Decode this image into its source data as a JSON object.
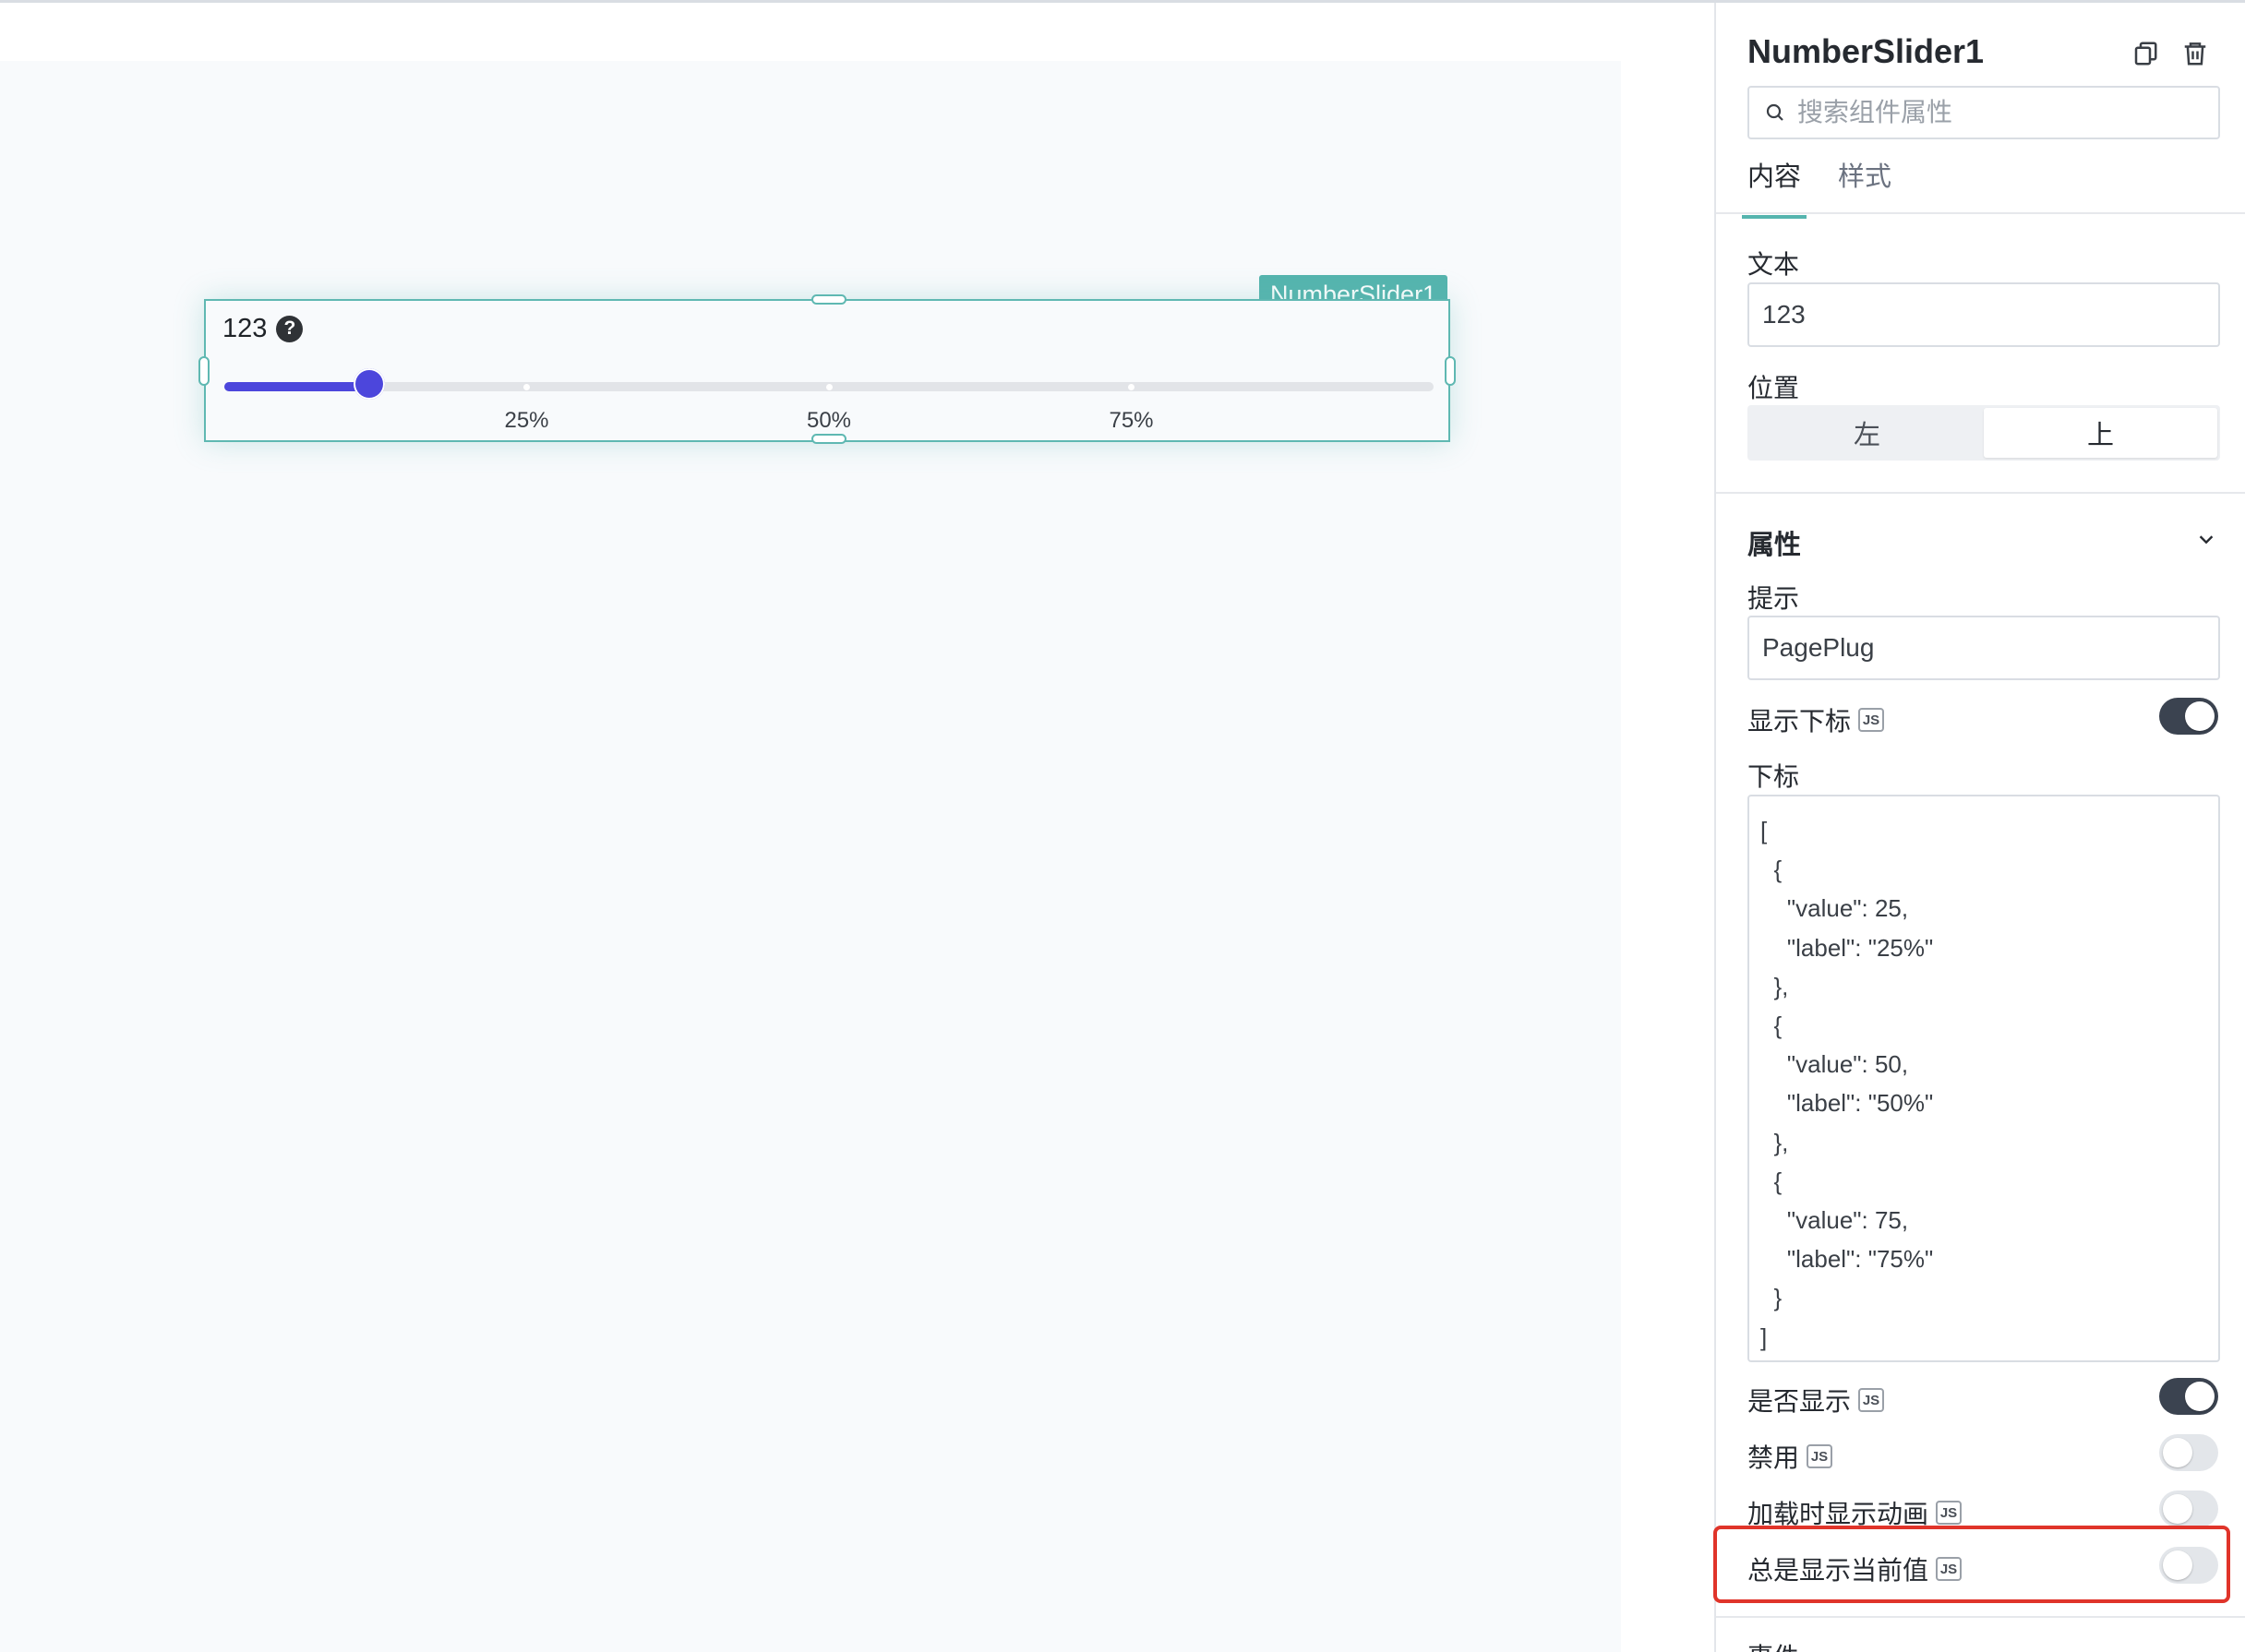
{
  "canvas": {
    "widget_tag": "NumberSlider1",
    "slider": {
      "label": "123",
      "value_percent": 12,
      "marks": [
        {
          "value": 25,
          "label": "25%"
        },
        {
          "value": 50,
          "label": "50%"
        },
        {
          "value": 75,
          "label": "75%"
        }
      ]
    }
  },
  "panel": {
    "title": "NumberSlider1",
    "copy_icon": "copy-icon",
    "delete_icon": "trash-icon",
    "search_placeholder": "搜索组件属性",
    "tabs": [
      {
        "label": "内容",
        "active": true
      },
      {
        "label": "样式",
        "active": false
      }
    ],
    "text_field": {
      "label": "文本",
      "value": "123"
    },
    "position": {
      "label": "位置",
      "options": [
        "左",
        "上"
      ],
      "selected": "上"
    },
    "properties": {
      "title": "属性",
      "hint": {
        "label": "提示",
        "value": "PagePlug"
      },
      "show_marks": {
        "label": "显示下标",
        "on": true
      },
      "marks": {
        "label": "下标",
        "code": "[\n  {\n    \"value\": 25,\n    \"label\": \"25%\"\n  },\n  {\n    \"value\": 50,\n    \"label\": \"50%\"\n  },\n  {\n    \"value\": 75,\n    \"label\": \"75%\"\n  }\n]"
      },
      "visible": {
        "label": "是否显示",
        "on": true
      },
      "disabled": {
        "label": "禁用",
        "on": false
      },
      "animate_loading": {
        "label": "加载时显示动画",
        "on": false
      },
      "always_show_value": {
        "label": "总是显示当前值",
        "on": false
      }
    },
    "js_badge": "JS",
    "events_title_cut": "事件"
  },
  "colors": {
    "accent": "#55b4ae",
    "slider": "#4c46dc",
    "highlight": "#e0342a"
  }
}
